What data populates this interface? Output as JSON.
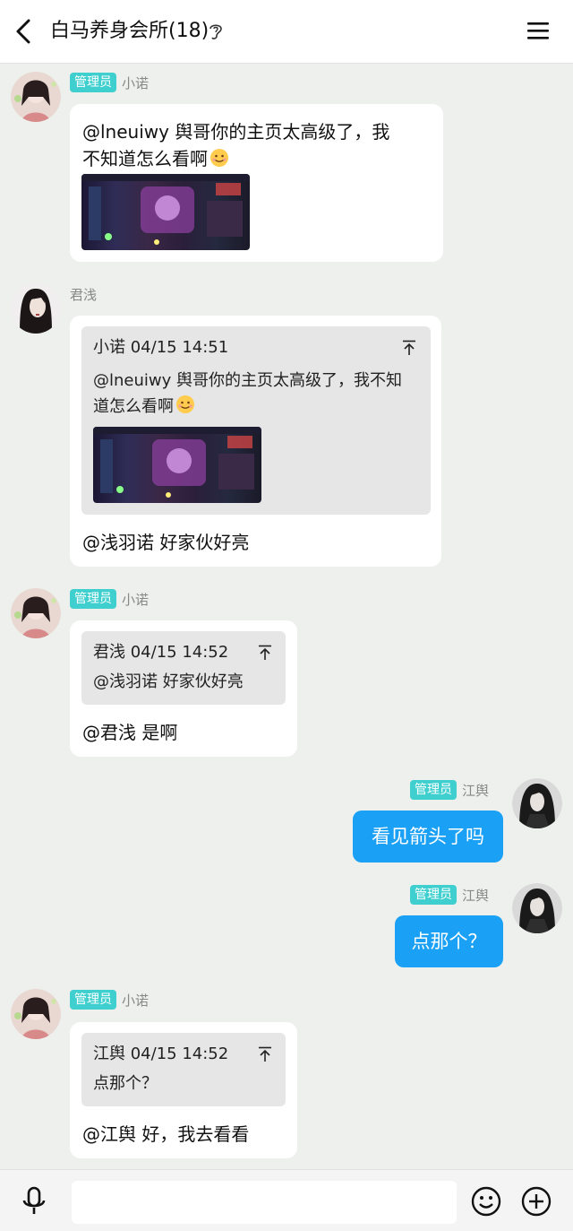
{
  "header": {
    "title": "白马养身会所(18)"
  },
  "messages": [
    {
      "role": "管理员",
      "name": "小诺",
      "text_l1": "@lneuiwy 舆哥你的主页太高级了，我",
      "text_l2": "不知道怎么看啊"
    },
    {
      "name": "君浅",
      "quote_head": "小诺 04/15 14:51",
      "quote_l1": "@lneuiwy 舆哥你的主页太高级了，我不知",
      "quote_l2": "道怎么看啊",
      "text": "@浅羽诺 好家伙好亮"
    },
    {
      "role": "管理员",
      "name": "小诺",
      "quote_head": "君浅 04/15 14:52",
      "quote_body": "@浅羽诺 好家伙好亮",
      "text": "@君浅 是啊"
    },
    {
      "role": "管理员",
      "name": "江舆",
      "text": "看见箭头了吗"
    },
    {
      "role": "管理员",
      "name": "江舆",
      "text": "点那个？"
    },
    {
      "role": "管理员",
      "name": "小诺",
      "quote_head": "江舆 04/15 14:52",
      "quote_body": "点那个？",
      "text": "@江舆 好，我去看看"
    }
  ],
  "composer": {
    "placeholder": ""
  },
  "colors": {
    "bubble_blue": "#1aa0f5",
    "badge": "#3fcfcf",
    "background": "#edf0ed"
  }
}
